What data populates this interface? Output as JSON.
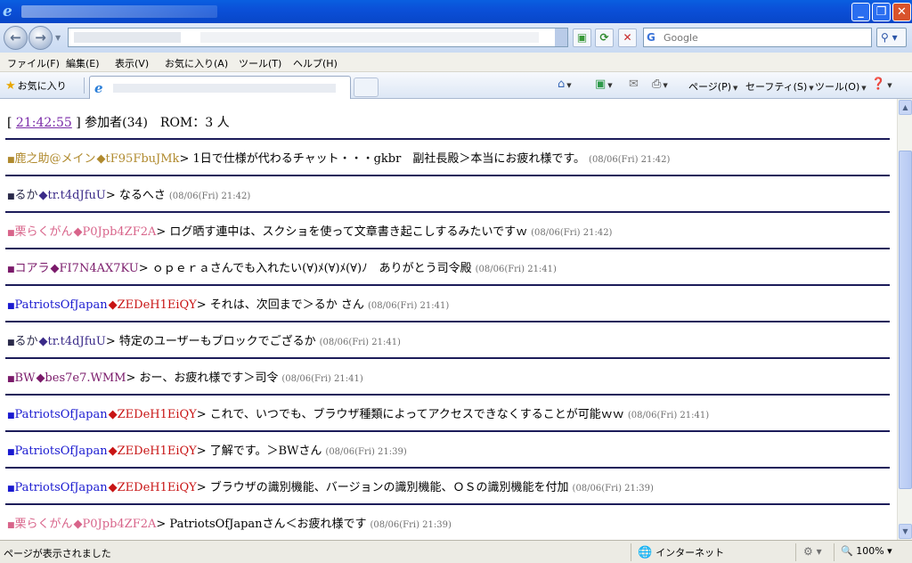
{
  "browser": {
    "search_placeholder": "Google",
    "menu": [
      "ファイル(F)",
      "編集(E)",
      "表示(V)",
      "お気に入り(A)",
      "ツール(T)",
      "ヘルプ(H)"
    ],
    "favorites_label": "お気に入り",
    "commands": {
      "page": "ページ(P)",
      "safety": "セーフティ(S)",
      "tools": "ツール(O)"
    },
    "status": {
      "text": "ページが表示されました",
      "zone": "インターネット",
      "zoom": "100%"
    }
  },
  "chat": {
    "header": {
      "open": "[",
      "time": "21:42:55",
      "rest": "] 参加者(34)　ROM：3 人"
    },
    "messages": [
      {
        "name": "鹿之助@メイン",
        "trip": "◆tF95FbuJMk",
        "text": "1日で仕様が代わるチャット・・・gkbr　副社長殿＞本当にお疲れ様です。",
        "ts": "(08/06(Fri) 21:42)",
        "color": "#b08a2e",
        "trip_color": "#b08a2e",
        "bullet_color": "#b08a2e"
      },
      {
        "name": "るか",
        "trip": "◆tr.t4dJfuU",
        "text": "なるへさ",
        "ts": "(08/06(Fri) 21:42)",
        "color": "#2a2a4a",
        "trip_color": "#3a2a88",
        "bullet_color": "#2a2a4a"
      },
      {
        "name": "栗らくがん",
        "trip": "◆P0Jpb4ZF2A",
        "text": "ログ晒す連中は、スクショを使って文章書き起こしするみたいですｗ",
        "ts": "(08/06(Fri) 21:42)",
        "color": "#d8648a",
        "trip_color": "#d8648a",
        "bullet_color": "#d8648a"
      },
      {
        "name": "コアラ",
        "trip": "◆FI7N4AX7KU",
        "text": "ｏｐｅｒａさんでも入れたい(∀)ﾒ(∀)ﾒ(∀)ﾉ　ありがとう司令殿",
        "ts": "(08/06(Fri) 21:41)",
        "color": "#7a1a6a",
        "trip_color": "#7a1a6a",
        "bullet_color": "#7a1a6a"
      },
      {
        "name": "PatriotsOfJapan",
        "trip": "◆ZEDeH1EiQY",
        "text": "それは、次回まで＞るか さん",
        "ts": "(08/06(Fri) 21:41)",
        "color": "#1a1ad0",
        "trip_color": "#c81414",
        "bullet_color": "#1a1ad0"
      },
      {
        "name": "るか",
        "trip": "◆tr.t4dJfuU",
        "text": "特定のユーザーもブロックでござるか",
        "ts": "(08/06(Fri) 21:41)",
        "color": "#2a2a4a",
        "trip_color": "#3a2a88",
        "bullet_color": "#2a2a4a"
      },
      {
        "name": "BW",
        "trip": "◆bes7e7.WMM",
        "text": "おー、お疲れ様です＞司令",
        "ts": "(08/06(Fri) 21:41)",
        "color": "#7a1a6a",
        "trip_color": "#7a1a6a",
        "bullet_color": "#7a1a6a"
      },
      {
        "name": "PatriotsOfJapan",
        "trip": "◆ZEDeH1EiQY",
        "text": "これで、いつでも、ブラウザ種類によってアクセスできなくすることが可能ｗｗ",
        "ts": "(08/06(Fri) 21:41)",
        "color": "#1a1ad0",
        "trip_color": "#c81414",
        "bullet_color": "#1a1ad0"
      },
      {
        "name": "PatriotsOfJapan",
        "trip": "◆ZEDeH1EiQY",
        "text": "了解です。＞BWさん",
        "ts": "(08/06(Fri) 21:39)",
        "color": "#1a1ad0",
        "trip_color": "#c81414",
        "bullet_color": "#1a1ad0"
      },
      {
        "name": "PatriotsOfJapan",
        "trip": "◆ZEDeH1EiQY",
        "text": "ブラウザの識別機能、バージョンの識別機能、ＯＳの識別機能を付加",
        "ts": "(08/06(Fri) 21:39)",
        "color": "#1a1ad0",
        "trip_color": "#c81414",
        "bullet_color": "#1a1ad0"
      },
      {
        "name": "栗らくがん",
        "trip": "◆P0Jpb4ZF2A",
        "text": "PatriotsOfJapanさん＜お疲れ様です",
        "ts": "(08/06(Fri) 21:39)",
        "color": "#d8648a",
        "trip_color": "#d8648a",
        "bullet_color": "#d8648a"
      }
    ]
  }
}
